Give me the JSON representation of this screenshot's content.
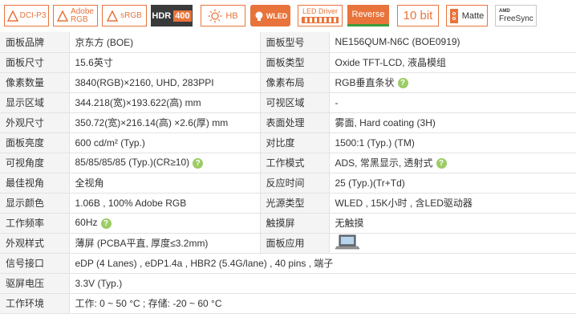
{
  "badges": [
    {
      "key": "dci",
      "label": "DCI-P3"
    },
    {
      "key": "adobe",
      "line1": "Adobe",
      "line2": "RGB"
    },
    {
      "key": "srgb",
      "label": "sRGB"
    },
    {
      "key": "hdr",
      "label": "HDR",
      "value": "400"
    },
    {
      "key": "hb",
      "label": "HB"
    },
    {
      "key": "wled",
      "label": "WLED"
    },
    {
      "key": "leddriver",
      "label": "LED Driver"
    },
    {
      "key": "reverse",
      "label": "Reverse"
    },
    {
      "key": "bit",
      "label": "10 bit"
    },
    {
      "key": "matte",
      "label": "Matte"
    },
    {
      "key": "freesync",
      "line1": "AMD",
      "line2": "FreeSync"
    }
  ],
  "rows": [
    {
      "l1": "面板品牌",
      "v1": "京东方 (BOE)",
      "l2": "面板型号",
      "v2": "NE156QUM-N6C (BOE0919)"
    },
    {
      "l1": "面板尺寸",
      "v1": "15.6英寸",
      "l2": "面板类型",
      "v2": "Oxide TFT-LCD, 液晶模组"
    },
    {
      "l1": "像素数量",
      "v1": "3840(RGB)×2160, UHD, 283PPI",
      "l2": "像素布局",
      "v2": "RGB垂直条状",
      "v2help": true
    },
    {
      "l1": "显示区域",
      "v1": "344.218(宽)×193.622(高) mm",
      "l2": "可视区域",
      "v2": "-"
    },
    {
      "l1": "外观尺寸",
      "v1": "350.72(宽)×216.14(高) ×2.6(厚) mm",
      "l2": "表面处理",
      "v2": "雾面, Hard coating (3H)"
    },
    {
      "l1": "面板亮度",
      "v1": "600 cd/m² (Typ.)",
      "l2": "对比度",
      "v2": "1500:1 (Typ.) (TM)"
    },
    {
      "l1": "可视角度",
      "v1": "85/85/85/85 (Typ.)(CR≥10)",
      "v1help": true,
      "l2": "工作模式",
      "v2": "ADS, 常黑显示, 透射式",
      "v2help": true
    },
    {
      "l1": "最佳视角",
      "v1": "全视角",
      "l2": "反应时间",
      "v2": "25 (Typ.)(Tr+Td)"
    },
    {
      "l1": "显示颜色",
      "v1": "1.06B , 100% Adobe RGB",
      "l2": "光源类型",
      "v2": "WLED , 15K小时 , 含LED驱动器"
    },
    {
      "l1": "工作频率",
      "v1": "60Hz",
      "v1help": true,
      "l2": "触摸屏",
      "v2": "无触摸"
    },
    {
      "l1": "外观样式",
      "v1": "薄屏 (PCBA平直, 厚度≤3.2mm)",
      "l2": "面板应用",
      "v2": "",
      "v2laptop": true
    },
    {
      "l1": "信号接口",
      "v1": "eDP (4 Lanes) , eDP1.4a , HBR2 (5.4G/lane) , 40 pins , 端子",
      "full": true
    },
    {
      "l1": "驱屏电压",
      "v1": "3.3V (Typ.)",
      "full": true
    },
    {
      "l1": "工作环境",
      "v1": "工作: 0 ~ 50 °C ; 存储: -20 ~ 60 °C",
      "full": true
    }
  ],
  "help_glyph": "?"
}
